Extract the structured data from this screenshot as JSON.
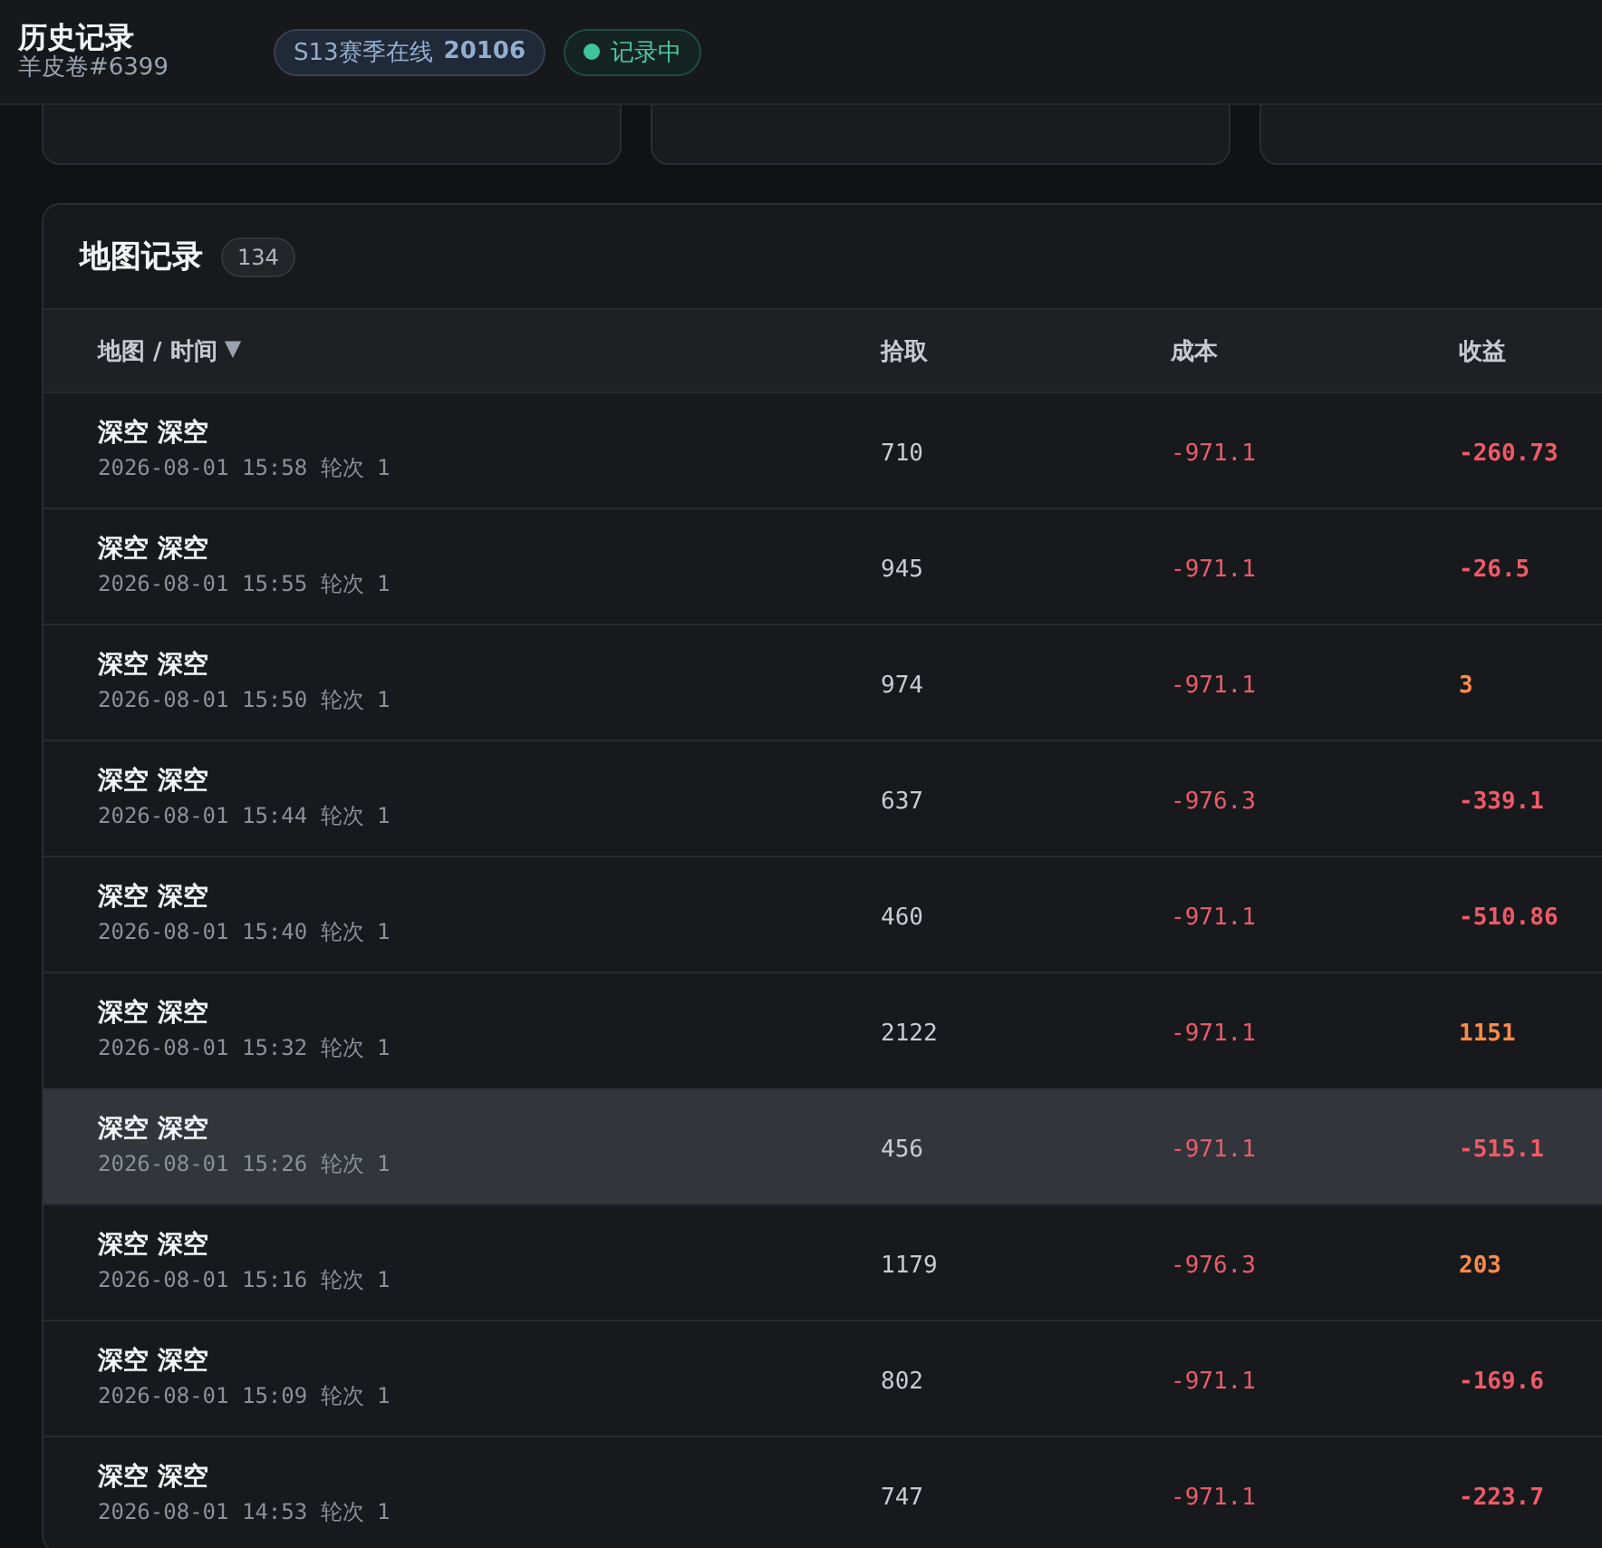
{
  "header": {
    "title": "历史记录",
    "subtitle": "羊皮卷#6399",
    "season": {
      "label": "S13赛季在线",
      "value": "20106"
    },
    "status": {
      "label": "记录中",
      "on": true
    }
  },
  "records": {
    "title": "地图记录",
    "count": "134",
    "columns": [
      {
        "label": "地图 / 时间",
        "sort": "▼"
      },
      {
        "label": "拾取"
      },
      {
        "label": "成本"
      },
      {
        "label": "收益"
      }
    ],
    "rows": [
      {
        "map": "深空 深空",
        "time": "2026-08-01 15:58 轮次 1",
        "pickup": "710",
        "cost": "-971.1",
        "profit": "-260.73",
        "kind": "loss",
        "selected": false
      },
      {
        "map": "深空 深空",
        "time": "2026-08-01 15:55 轮次 1",
        "pickup": "945",
        "cost": "-971.1",
        "profit": "-26.5",
        "kind": "loss",
        "selected": false
      },
      {
        "map": "深空 深空",
        "time": "2026-08-01 15:50 轮次 1",
        "pickup": "974",
        "cost": "-971.1",
        "profit": "3",
        "kind": "gain",
        "selected": false
      },
      {
        "map": "深空 深空",
        "time": "2026-08-01 15:44 轮次 1",
        "pickup": "637",
        "cost": "-976.3",
        "profit": "-339.1",
        "kind": "loss",
        "selected": false
      },
      {
        "map": "深空 深空",
        "time": "2026-08-01 15:40 轮次 1",
        "pickup": "460",
        "cost": "-971.1",
        "profit": "-510.86",
        "kind": "loss",
        "selected": false
      },
      {
        "map": "深空 深空",
        "time": "2026-08-01 15:32 轮次 1",
        "pickup": "2122",
        "cost": "-971.1",
        "profit": "1151",
        "kind": "gain",
        "selected": false
      },
      {
        "map": "深空 深空",
        "time": "2026-08-01 15:26 轮次 1",
        "pickup": "456",
        "cost": "-971.1",
        "profit": "-515.1",
        "kind": "loss",
        "selected": true
      },
      {
        "map": "深空 深空",
        "time": "2026-08-01 15:16 轮次 1",
        "pickup": "1179",
        "cost": "-976.3",
        "profit": "203",
        "kind": "gain",
        "selected": false
      },
      {
        "map": "深空 深空",
        "time": "2026-08-01 15:09 轮次 1",
        "pickup": "802",
        "cost": "-971.1",
        "profit": "-169.6",
        "kind": "loss",
        "selected": false
      },
      {
        "map": "深空 深空",
        "time": "2026-08-01 14:53 轮次 1",
        "pickup": "747",
        "cost": "-971.1",
        "profit": "-223.7",
        "kind": "loss",
        "selected": false
      }
    ]
  }
}
